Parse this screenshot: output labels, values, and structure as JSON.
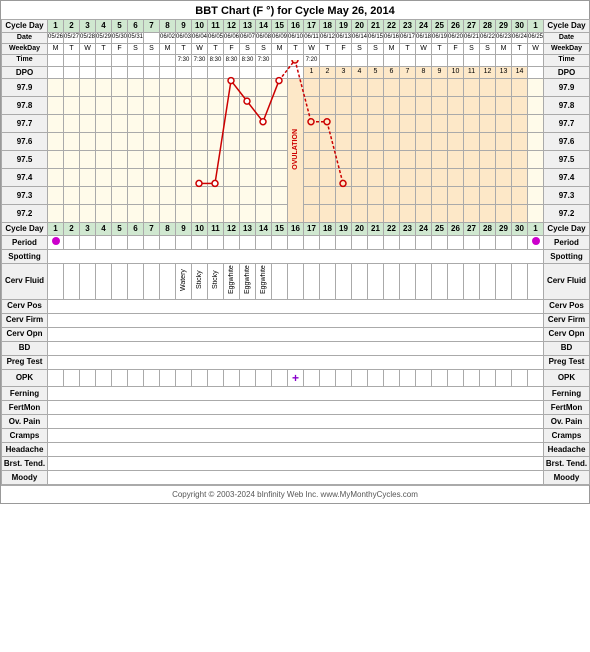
{
  "title": "BBT Chart (F °) for Cycle May 26, 2014",
  "headers": {
    "cycleDay": "Cycle Day",
    "date": "Date",
    "weekDay": "WeekDay",
    "time": "Time",
    "dpo": "DPO"
  },
  "cycleDays": [
    1,
    2,
    3,
    4,
    5,
    6,
    7,
    8,
    9,
    10,
    11,
    12,
    13,
    14,
    15,
    16,
    17,
    18,
    19,
    20,
    21,
    22,
    23,
    24,
    25,
    26,
    27,
    28,
    29,
    30,
    1
  ],
  "dates": [
    "05/26",
    "05/27",
    "05/28",
    "05/29",
    "05/30",
    "05/31",
    "06/02",
    "06/03",
    "06/04",
    "06/05",
    "06/06",
    "06/07",
    "06/08",
    "06/09",
    "06/10",
    "06/11",
    "06/12",
    "06/13",
    "06/14",
    "06/15",
    "06/16",
    "06/17",
    "06/18",
    "06/19",
    "06/20",
    "06/21",
    "06/22",
    "06/23",
    "06/24",
    "06/25",
    ""
  ],
  "weekdays": [
    "M",
    "T",
    "W",
    "T",
    "F",
    "S",
    "S",
    "M",
    "T",
    "W",
    "T",
    "F",
    "S",
    "S",
    "M",
    "T",
    "W",
    "T",
    "F",
    "S",
    "S",
    "M",
    "T",
    "W",
    "T",
    "F",
    "S",
    "S",
    "M",
    "T",
    "W"
  ],
  "times": [
    "",
    "",
    "",
    "",
    "",
    "",
    "",
    "",
    "7:30",
    "7:30",
    "8:30",
    "8:30",
    "8:30",
    "7:30",
    "",
    "",
    "7:20",
    "",
    "",
    "",
    "",
    "",
    "",
    "",
    "",
    "",
    "",
    "",
    "",
    "",
    ""
  ],
  "dpoValues": [
    "",
    "",
    "",
    "",
    "",
    "",
    "",
    "",
    "",
    "",
    "",
    "",
    "",
    "",
    "",
    "",
    "1",
    "2",
    "3",
    "4",
    "5",
    "6",
    "7",
    "8",
    "9",
    "10",
    "11",
    "12",
    "13",
    "14",
    ""
  ],
  "bbtTemps": {
    "97.9": 0,
    "97.8": 1,
    "97.7": 2,
    "97.6": 3,
    "97.5": 4,
    "97.4": 5,
    "97.3": 6,
    "97.2": 7
  },
  "bbtLabels": [
    "97.9",
    "97.8",
    "97.7",
    "97.6",
    "97.5",
    "97.4",
    "97.3",
    "97.2"
  ],
  "dataPoints": [
    {
      "day": 10,
      "temp": 97.3
    },
    {
      "day": 11,
      "temp": 97.3
    },
    {
      "day": 12,
      "temp": 97.8
    },
    {
      "day": 13,
      "temp": 97.7
    },
    {
      "day": 14,
      "temp": 97.6
    },
    {
      "day": 15,
      "temp": 97.8
    },
    {
      "day": 16,
      "temp": 97.9
    },
    {
      "day": 17,
      "temp": 97.6
    },
    {
      "day": 18,
      "temp": 97.6
    },
    {
      "day": 19,
      "temp": 97.3
    }
  ],
  "ovulationDay": 16,
  "cervFluid": {
    "9": "Watery",
    "10": "Sticky",
    "11": "Sticky",
    "12": "Eggwhite",
    "13": "Eggwhite",
    "14": "Eggwhite"
  },
  "rowLabels": {
    "period": "Period",
    "spotting": "Spotting",
    "cervFluid": "Cerv Fluid",
    "cervPos": "Cerv Pos",
    "cervFirm": "Cerv Firm",
    "cervOpn": "Cerv Opn",
    "bd": "BD",
    "pregTest": "Preg Test",
    "opk": "OPK",
    "ferning": "Ferning",
    "fertMon": "FertMon",
    "ovPain": "Ov. Pain",
    "cramps": "Cramps",
    "headache": "Headache",
    "brstTend": "Brst. Tend.",
    "moody": "Moody"
  },
  "periodDays": [
    1
  ],
  "periodDays2": [
    31
  ],
  "opkPlus": [
    16
  ],
  "footer": "Copyright © 2003-2024 bInfinity Web Inc.   www.MyMonthyCycles.com"
}
